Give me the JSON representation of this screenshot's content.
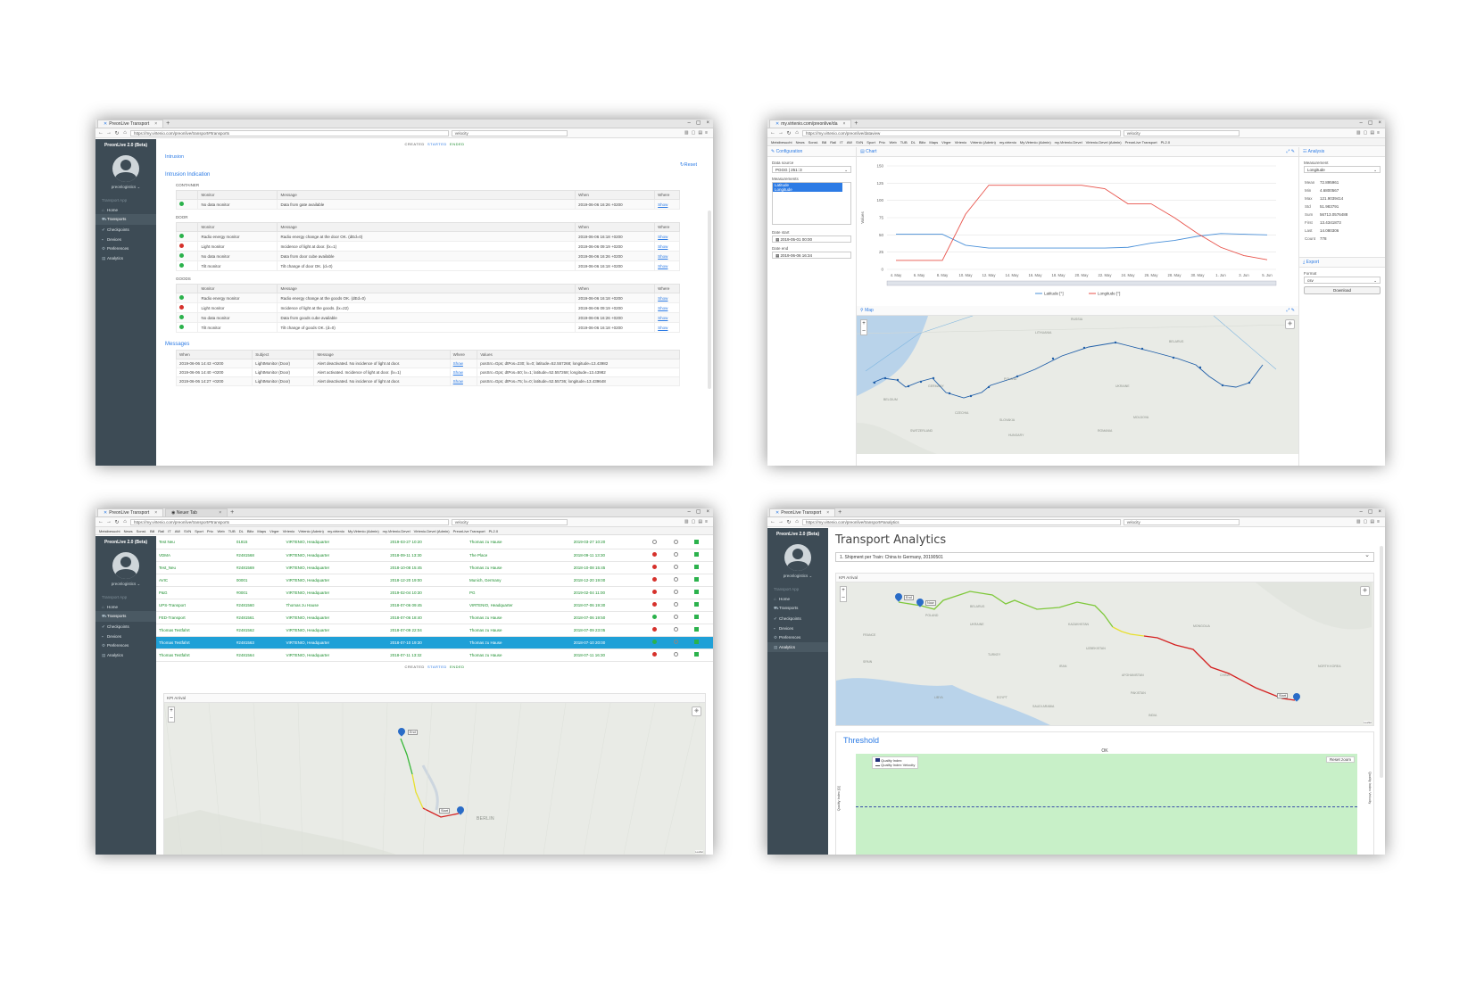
{
  "browser": {
    "app_tab": "PreonLive Transport",
    "new_tab": "Neuer Tab",
    "search_value": "velocity",
    "url_transports": "https://my.virtenio.com/preonlive/transport#!transports",
    "url_dataview": "https://my.virtenio.com/preonlive/dataview",
    "url_analytics": "https://my.virtenio.com/preonlive/transport#!analytics",
    "tab_dataview": "my.virtenio.com/preonlive/da",
    "bookmarks": [
      "Meistbesucht",
      "News",
      "Sonst.",
      "Bill",
      "Rail",
      "IT",
      "AW",
      "SVN",
      "Sport",
      "Priv.",
      "Web",
      "TUB",
      "DL",
      "Blitz",
      "Maps",
      "Virger",
      "Virtenio",
      "Virtenio (Admin)",
      "my.virtenio",
      "My.Virtenio (Admin)",
      "my.Virtenio.Devel",
      "Virtenio.Devel (Admin)",
      "PreonLive Transport",
      "PL2.0"
    ]
  },
  "sidebar": {
    "app_title": "PreonLive 2.0 (Beta)",
    "user": "preonlogistics ⌄",
    "section": "Transport App",
    "items": [
      {
        "icon": "home-icon",
        "glyph": "⌂",
        "label": "Home"
      },
      {
        "icon": "truck-icon",
        "glyph": "⛟",
        "label": "Transports"
      },
      {
        "icon": "check-icon",
        "glyph": "✔",
        "label": "Checkpoints"
      },
      {
        "icon": "device-icon",
        "glyph": "▪",
        "label": "Devices"
      },
      {
        "icon": "gear-icon",
        "glyph": "⚙",
        "label": "Preferences"
      },
      {
        "icon": "chart-icon",
        "glyph": "▤",
        "label": "Analytics"
      }
    ]
  },
  "status_filter": {
    "created": "CREATED",
    "started": "STARTED",
    "ended": "ENDED"
  },
  "screen1": {
    "intrusion": "Intrusion",
    "reset": "Reset",
    "indication_title": "Intrusion Indication",
    "columns": [
      "Monitor",
      "Message",
      "When",
      "Where"
    ],
    "groups": [
      {
        "name": "CONTAINER",
        "rows": [
          {
            "status": "green",
            "monitor": "No data monitor",
            "message": "Data from gate available",
            "when": "2019-06-06 16:26 +0200",
            "where": "Show"
          }
        ]
      },
      {
        "name": "DOOR",
        "rows": [
          {
            "status": "green",
            "monitor": "Radio energy monitor",
            "message": "Radio energy change at the door OK. (dEd=0)",
            "when": "2019-06-06 16:18 +0200",
            "where": "Show"
          },
          {
            "status": "red",
            "monitor": "Light monitor",
            "message": "Incidence of light at door. (lx=1)",
            "when": "2019-06-06 09:19 +0200",
            "where": "Show"
          },
          {
            "status": "green",
            "monitor": "No data monitor",
            "message": "Data from door cube available",
            "when": "2019-06-06 16:26 +0200",
            "where": "Show"
          },
          {
            "status": "green",
            "monitor": "Tilt monitor",
            "message": "Tilt change of door OK. (d=0)",
            "when": "2019-06-06 16:18 +0200",
            "where": "Show"
          }
        ]
      },
      {
        "name": "GOODS",
        "rows": [
          {
            "status": "green",
            "monitor": "Radio energy monitor",
            "message": "Radio energy change at the goods OK. (dEd=0)",
            "when": "2019-06-06 16:18 +0200",
            "where": "Show"
          },
          {
            "status": "red",
            "monitor": "Light monitor",
            "message": "Incidence of light at the goods. (lx=22)",
            "when": "2019-06-06 09:19 +0200",
            "where": "Show"
          },
          {
            "status": "green",
            "monitor": "No data monitor",
            "message": "Data from goods cube available",
            "when": "2019-06-06 16:26 +0200",
            "where": "Show"
          },
          {
            "status": "green",
            "monitor": "Tilt monitor",
            "message": "Tilt change of goods OK. (d=0)",
            "when": "2019-06-06 16:18 +0200",
            "where": "Show"
          }
        ]
      }
    ],
    "messages_title": "Messages",
    "message_columns": [
      "When",
      "Subject",
      "Message",
      "Where",
      "Values"
    ],
    "messages": [
      {
        "when": "2019-06-06 14:43 +0200",
        "subject": "LightMonitor (Door)",
        "message": "Alert deactivated. No incidence of light at door.",
        "where": "Show",
        "values": "posSrc=Gps; dtPos=230; lx=0; latitude=52.557268; longitude=13.43982"
      },
      {
        "when": "2019-06-06 14:40 +0200",
        "subject": "LightMonitor (Door)",
        "message": "Alert activated. Incidence of light at door. (lx=1)",
        "where": "Show",
        "values": "posSrc=Gps; dtPos=50; lx=1; latitude=52.557268; longitude=13.43982"
      },
      {
        "when": "2019-06-06 14:27 +0200",
        "subject": "LightMonitor (Door)",
        "message": "Alert deactivated. No incidence of light at door.",
        "where": "Show",
        "values": "posSrc=Gps; dtPos=75; lx=0; latitude=52.55736; longitude=13.439648"
      }
    ]
  },
  "screen2": {
    "configuration": "Configuration",
    "data_source_label": "Data source",
    "data_source": "PGGG | 251::3",
    "measurements_label": "Measurements",
    "measurements": [
      "Latitude",
      "Longitude"
    ],
    "date_start_label": "Date start",
    "date_start": "2019-05-01 00:00",
    "date_end_label": "Date end",
    "date_end": "2019-06-06 16:34",
    "chart_title": "Chart",
    "map_title": "Map",
    "analysis_title": "Analysis",
    "measurement_label": "Measurement",
    "measurement_value": "Longitude",
    "stats": [
      {
        "k": "Mean",
        "v": "72.895961"
      },
      {
        "k": "Min",
        "v": "4.6800567"
      },
      {
        "k": "Max",
        "v": "121.9039414"
      },
      {
        "k": "Std",
        "v": "51.983791"
      },
      {
        "k": "Sum",
        "v": "56713.0576488"
      },
      {
        "k": "First",
        "v": "13.4341873"
      },
      {
        "k": "Last",
        "v": "14.080306"
      },
      {
        "k": "Count",
        "v": "778"
      }
    ],
    "export_title": "Export",
    "format_label": "Format",
    "format_value": "csv",
    "download": "Download",
    "map_labels": [
      "BELGIUM",
      "GERMANY",
      "POLAND",
      "UKRAINE",
      "BELARUS",
      "LITHUANIA",
      "RUSSIA",
      "CZECHIA",
      "SLOVAKIA",
      "HUNGARY",
      "ROMANIA",
      "SWITZERLAND",
      "MOLDOVA"
    ]
  },
  "chart_data": {
    "type": "line",
    "x": [
      "4. May",
      "6. May",
      "8. May",
      "10. May",
      "12. May",
      "14. May",
      "16. May",
      "18. May",
      "20. May",
      "22. May",
      "24. May",
      "26. May",
      "28. May",
      "30. May",
      "1. Jun",
      "3. Jun",
      "5. Jun"
    ],
    "series": [
      {
        "name": "Latitude [°]",
        "color": "#4a90d9",
        "values": [
          51,
          51,
          51,
          35,
          31,
          31,
          31,
          31,
          31,
          31,
          32,
          38,
          42,
          48,
          52,
          51,
          50
        ]
      },
      {
        "name": "Longitude [°]",
        "color": "#e8524a",
        "values": [
          13,
          13,
          13,
          80,
          122,
          122,
          122,
          122,
          122,
          117,
          95,
          95,
          75,
          52,
          32,
          20,
          14
        ]
      }
    ],
    "ylabel": "Values",
    "ylim": [
      0,
      150
    ],
    "yticks": [
      0,
      25,
      50,
      75,
      100,
      125,
      150
    ],
    "grid": true,
    "legend": "bottom"
  },
  "screen3": {
    "rows": [
      [
        "Test Neu",
        "01815",
        "VIRTENIO, Headquarter",
        "2019-03-27 10:20",
        "Thomas zu Hause",
        "2019-03-27 10:20",
        "ring",
        "ring"
      ],
      [
        "VDMA",
        "#2481568",
        "VIRTENIO, Headquarter",
        "2018-09-11 13:30",
        "The Place",
        "2018-09-11 13:30",
        "red",
        "ring"
      ],
      [
        "Test_Neu",
        "#2481569",
        "VIRTENIO, Headquarter",
        "2018-10-08 15:45",
        "Thomas zu Hause",
        "2018-10-08 15:45",
        "red",
        "ring"
      ],
      [
        "AVIC",
        "00001",
        "VIRTENIO, Headquarter",
        "2018-12-20 19:00",
        "Munich, Germany",
        "2018-12-20 19:00",
        "red",
        "ring"
      ],
      [
        "P&G",
        "#0001",
        "VIRTENIO, Headquarter",
        "2019-02-04 10:30",
        "PG",
        "2019-02-04 11:00",
        "red",
        "ring"
      ],
      [
        "UPS-Transport",
        "#2481560",
        "Thomas zu Hause",
        "2018-07-06 09:45",
        "VIRTENIO, Headquarter",
        "2018-07-06 19:30",
        "red",
        "ring"
      ],
      [
        "FED-Transport",
        "#2481561",
        "VIRTENIO, Headquarter",
        "2018-07-06 18:40",
        "Thomas zu Hause",
        "2018-07-06 19:50",
        "green",
        "ring"
      ],
      [
        "Thomas Testfahrt",
        "#2481562",
        "VIRTENIO, Headquarter",
        "2018-07-09 22:04",
        "Thomas zu Hause",
        "2018-07-09 23:05",
        "red",
        "ring"
      ],
      [
        "Thomas Testfahrt",
        "#2481563",
        "VIRTENIO, Headquarter",
        "2018-07-10 19:30",
        "Thomas zu Hause",
        "2018-07-10 20:00",
        "green",
        "ring"
      ],
      [
        "Thomas Testfahrt",
        "#2481564",
        "VIRTENIO, Headquarter",
        "2018-07-11 13:32",
        "Thomas zu Hause",
        "2018-07-11 16:30",
        "red",
        "ring"
      ]
    ],
    "highlight_row": 8,
    "kpi_title": "KPI Arrival",
    "end_label": "End",
    "start_label": "Start",
    "city": "BERLIN",
    "attribution": "Leaflet"
  },
  "screen4": {
    "title": "Transport Analytics",
    "shipment": "1. Shipment per Train: China to Germany, 20190501",
    "kpi_title": "KPI Arrival",
    "end_label": "End",
    "now_label": "Now",
    "start_label": "Start",
    "map_labels": [
      "FRANCE",
      "SPAIN",
      "POLAND",
      "UKRAINE",
      "BELARUS",
      "KAZAKHSTAN",
      "MONGOLIA",
      "TURKEY",
      "IRAN",
      "CHINA",
      "UZBEKISTAN",
      "AFGHANISTAN",
      "PAKISTAN",
      "LIBYA",
      "EGYPT",
      "SAUDI ARABIA",
      "NORTH KOREA",
      "INDIA"
    ],
    "threshold_title": "Threshold",
    "ok_label": "OK",
    "reset_zoom": "Reset zoom",
    "legend": [
      "Quality Index",
      "Quality Index Velocity"
    ],
    "ylabel_left": "Quality Index [Q]",
    "ylabel_right": "Quality Index Velocity",
    "attribution": "Leaflet"
  }
}
